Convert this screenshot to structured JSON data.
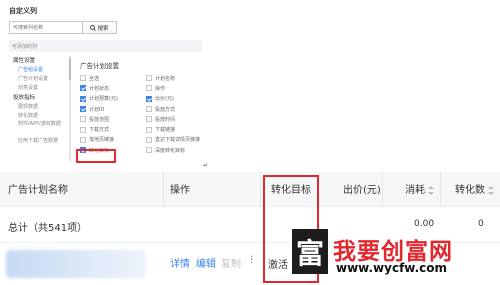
{
  "panel": {
    "title": "自定义列",
    "search_placeholder": "可搜索列名称",
    "search_button": "搜索",
    "selected_bar": "可添加的列"
  },
  "left_nav": [
    {
      "label": "属性设置",
      "type": "header"
    },
    {
      "label": "广告组设置",
      "type": "item",
      "active": true
    },
    {
      "label": "广告计划设置",
      "type": "item"
    },
    {
      "label": "创意设置",
      "type": "item"
    },
    {
      "label": "投放指标",
      "type": "header"
    },
    {
      "label": "展现数据",
      "type": "item"
    },
    {
      "label": "转化数据",
      "type": "item"
    },
    {
      "label": "附件/APP/游戏数据",
      "type": "item",
      "tall": true
    },
    {
      "label": "应用下载广告数据",
      "type": "item"
    }
  ],
  "options": {
    "title": "广告计划设置",
    "items": [
      {
        "label": "全选",
        "checked": false
      },
      {
        "label": "计划名称",
        "checked": false
      },
      {
        "label": "计划状态",
        "checked": true
      },
      {
        "label": "操作",
        "checked": false
      },
      {
        "label": "计划预算(元)",
        "checked": true
      },
      {
        "label": "出价(元)",
        "checked": true
      },
      {
        "label": "计划ID",
        "checked": true
      },
      {
        "label": "投放方式",
        "checked": false
      },
      {
        "label": "投放范围",
        "checked": false
      },
      {
        "label": "投放时间",
        "checked": false
      },
      {
        "label": "下载方式",
        "checked": false
      },
      {
        "label": "下载链接",
        "checked": false
      },
      {
        "label": "落地页链接",
        "checked": false
      },
      {
        "label": "直达下载详情页链接",
        "checked": false
      },
      {
        "label": "转化目标",
        "checked": true
      },
      {
        "label": "深度转化目标",
        "checked": false
      }
    ]
  },
  "table": {
    "headers": {
      "name": "广告计划名称",
      "ops": "操作",
      "conversion_target": "转化目标",
      "bid": "出价(元)",
      "cost": "消耗",
      "conversions": "转化数"
    },
    "total_row": {
      "label": "总计（共541项）",
      "cost": "0.00",
      "conversions": "0"
    },
    "data_row": {
      "actions": {
        "detail": "详情",
        "edit": "编辑",
        "copy": "复制"
      },
      "conversion_target": "激活"
    }
  },
  "watermark": {
    "logo": "富",
    "title": "我要创富网",
    "url": "www.wycfw.com"
  },
  "colors": {
    "accent": "#3b84e8",
    "highlight_red": "#e0282e"
  }
}
